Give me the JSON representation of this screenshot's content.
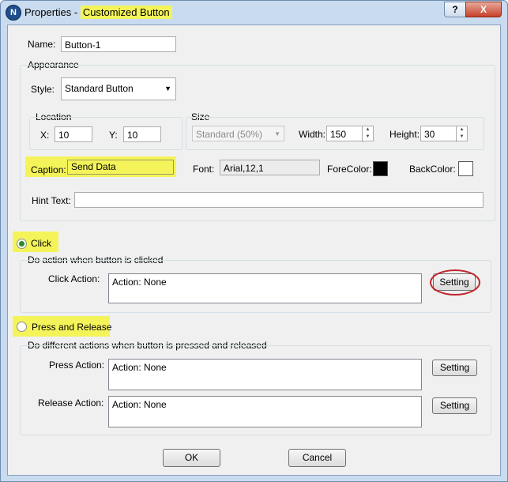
{
  "window": {
    "title_prefix": "Properties - ",
    "title_highlight": "Customized Button",
    "app_icon_letter": "N",
    "help_glyph": "?",
    "close_glyph": "X"
  },
  "name": {
    "label": "Name:",
    "value": "Button-1"
  },
  "appearance": {
    "group_label": "Appearance",
    "style_label": "Style:",
    "style_value": "Standard Button",
    "location": {
      "group_label": "Location",
      "x_label": "X:",
      "x_value": "10",
      "y_label": "Y:",
      "y_value": "10"
    },
    "size": {
      "group_label": "Size",
      "preset_value": "Standard    (50%)",
      "width_label": "Width:",
      "width_value": "150",
      "height_label": "Height:",
      "height_value": "30"
    },
    "caption_label": "Caption:",
    "caption_value": "Send Data",
    "font_label": "Font:",
    "font_value": "Arial,12,1",
    "forecolor_label": "ForeColor:",
    "forecolor": "#000000",
    "backcolor_label": "BackColor:",
    "backcolor": "#ffffff",
    "hint_label": "Hint Text:",
    "hint_value": ""
  },
  "click_mode": {
    "label": "Click",
    "selected": true,
    "group_label": "Do action when button is clicked",
    "action_label": "Click Action:",
    "action_value": "Action: None",
    "setting_label": "Setting"
  },
  "press_mode": {
    "label": "Press and Release",
    "selected": false,
    "group_label": "Do different actions when button is pressed and released",
    "press_label": "Press Action:",
    "press_value": "Action: None",
    "press_setting_label": "Setting",
    "release_label": "Release Action:",
    "release_value": "Action: None",
    "release_setting_label": "Setting"
  },
  "footer": {
    "ok_label": "OK",
    "cancel_label": "Cancel"
  },
  "colors": {
    "highlight": "#f4f45a",
    "annotation_circle": "#c0262b",
    "radio_selected": "#2a8a2a"
  }
}
